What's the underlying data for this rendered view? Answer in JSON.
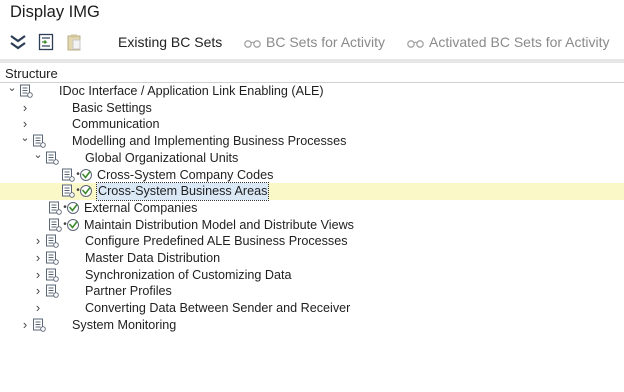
{
  "window": {
    "title": "Display IMG"
  },
  "toolbar": {
    "existing_bc_sets": "Existing BC Sets",
    "bc_sets_for_activity": "BC Sets for Activity",
    "activated_bc_sets_for_activity": "Activated BC Sets for Activity"
  },
  "structure": {
    "header": "Structure",
    "nodes": [
      {
        "label": "IDoc Interface / Application Link Enabling (ALE)",
        "level": 0,
        "toggle": "expanded",
        "doc_icon": true,
        "exec_icon": false
      },
      {
        "label": "Basic Settings",
        "level": 1,
        "toggle": "collapsed",
        "doc_icon": false,
        "exec_icon": false
      },
      {
        "label": "Communication",
        "level": 1,
        "toggle": "collapsed",
        "doc_icon": false,
        "exec_icon": false
      },
      {
        "label": "Modelling and Implementing Business Processes",
        "level": 1,
        "toggle": "expanded",
        "doc_icon": true,
        "exec_icon": false
      },
      {
        "label": "Global Organizational Units",
        "level": 2,
        "toggle": "expanded",
        "doc_icon": true,
        "exec_icon": false
      },
      {
        "label": "Cross-System Company Codes",
        "level": 3,
        "toggle": "leaf",
        "doc_icon": true,
        "exec_icon": true
      },
      {
        "label": "Cross-System Business Areas",
        "level": 3,
        "toggle": "leaf",
        "doc_icon": true,
        "exec_icon": true,
        "selected": true
      },
      {
        "label": "External Companies",
        "level": 2,
        "toggle": "leaf",
        "doc_icon": true,
        "exec_icon": true
      },
      {
        "label": "Maintain Distribution Model and Distribute Views",
        "level": 2,
        "toggle": "leaf",
        "doc_icon": true,
        "exec_icon": true
      },
      {
        "label": "Configure Predefined ALE Business Processes",
        "level": 2,
        "toggle": "collapsed",
        "doc_icon": true,
        "exec_icon": false
      },
      {
        "label": "Master Data Distribution",
        "level": 2,
        "toggle": "collapsed",
        "doc_icon": true,
        "exec_icon": false
      },
      {
        "label": "Synchronization of Customizing Data",
        "level": 2,
        "toggle": "collapsed",
        "doc_icon": true,
        "exec_icon": false
      },
      {
        "label": "Partner Profiles",
        "level": 2,
        "toggle": "collapsed",
        "doc_icon": true,
        "exec_icon": false
      },
      {
        "label": "Converting Data Between Sender and Receiver",
        "level": 2,
        "toggle": "collapsed",
        "doc_icon": false,
        "exec_icon": false
      },
      {
        "label": "System Monitoring",
        "level": 1,
        "toggle": "collapsed",
        "doc_icon": true,
        "exec_icon": false
      }
    ]
  }
}
